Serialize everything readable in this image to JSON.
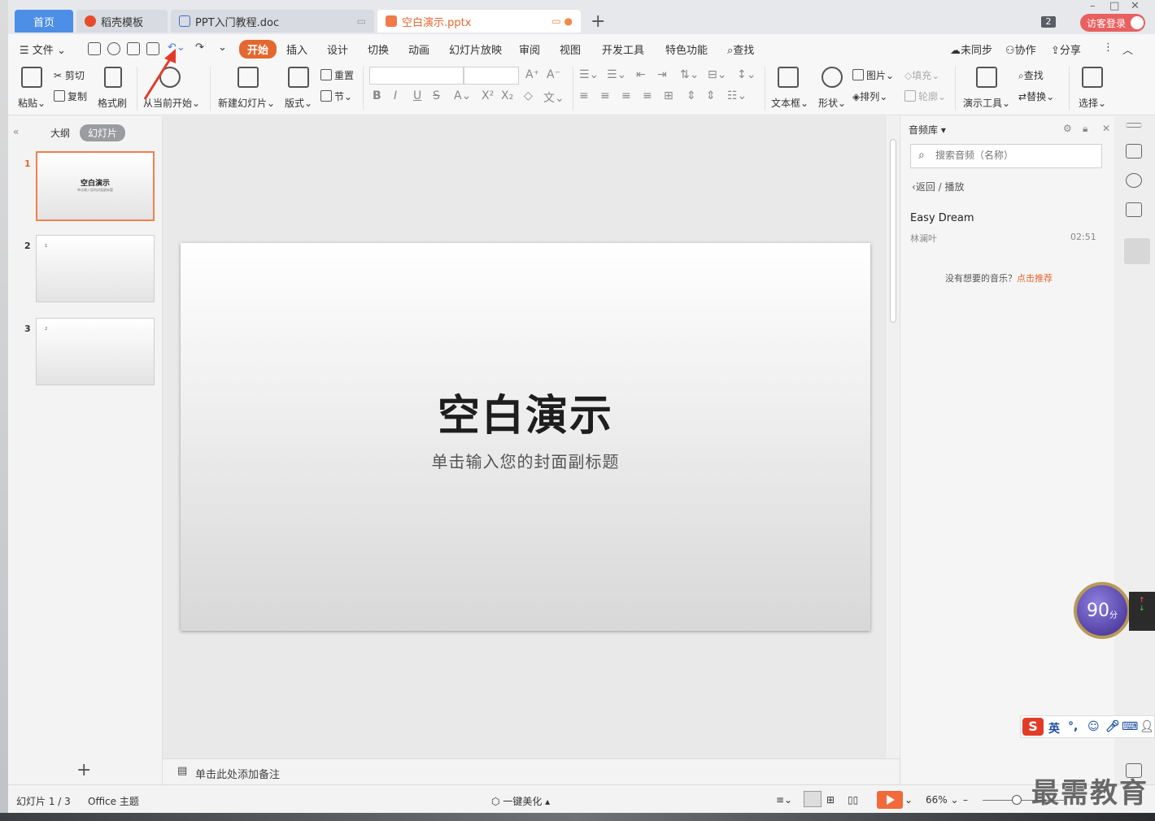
{
  "tabs": {
    "home": "首页",
    "templates": "稻壳模板",
    "doc": "PPT入门教程.doc",
    "pptx": "空白演示.pptx",
    "count": "2",
    "guest_login": "访客登录"
  },
  "menu": {
    "file": "文件",
    "items": [
      "开始",
      "插入",
      "设计",
      "切换",
      "动画",
      "幻灯片放映",
      "审阅",
      "视图",
      "开发工具",
      "特色功能"
    ],
    "search": "查找",
    "sync": "未同步",
    "collab": "协作",
    "share": "分享"
  },
  "ribbon": {
    "paste": "粘贴",
    "cut": "剪切",
    "copy": "复制",
    "format_painter": "格式刷",
    "from_current": "从当前开始",
    "new_slide": "新建幻灯片",
    "layout": "版式",
    "reset": "重置",
    "section": "节",
    "textbox": "文本框",
    "shape": "形状",
    "picture": "图片",
    "fill": "填充",
    "arrange": "排列",
    "outline": "轮廓",
    "present_tools": "演示工具",
    "find": "查找",
    "replace": "替换",
    "select": "选择"
  },
  "left_panel": {
    "outline_tab": "大纲",
    "slides_tab": "幻灯片",
    "slides": [
      {
        "num": "1",
        "title": "空白演示",
        "subtitle": "单击输入您的封面副标题",
        "dot": ""
      },
      {
        "num": "2",
        "title": "",
        "subtitle": "",
        "dot": "1"
      },
      {
        "num": "3",
        "title": "",
        "subtitle": "",
        "dot": "2"
      }
    ]
  },
  "slide": {
    "title": "空白演示",
    "subtitle": "单击输入您的封面副标题"
  },
  "notes_placeholder": "单击此处添加备注",
  "audio_pane": {
    "title": "音频库",
    "search_placeholder": "搜索音频（名称）",
    "back": "返回",
    "crumb_sep": "/",
    "crumb_current": "播放",
    "song": "Easy Dream",
    "artist": "林澜叶",
    "duration": "02:51",
    "footer_text": "没有想要的音乐？",
    "footer_link": "点击推荐"
  },
  "status": {
    "slide_info": "幻灯片 1 / 3",
    "theme": "Office 主题",
    "beautify": "一键美化",
    "zoom": "66%"
  },
  "overlay": {
    "score": "90",
    "score_unit": "分",
    "ime_logo": "S",
    "ime_mode": "英",
    "watermark": "最需教育"
  },
  "colors": {
    "accent": "#e4672f",
    "tab_home": "#4d8ee6",
    "guest": "#e86060"
  }
}
